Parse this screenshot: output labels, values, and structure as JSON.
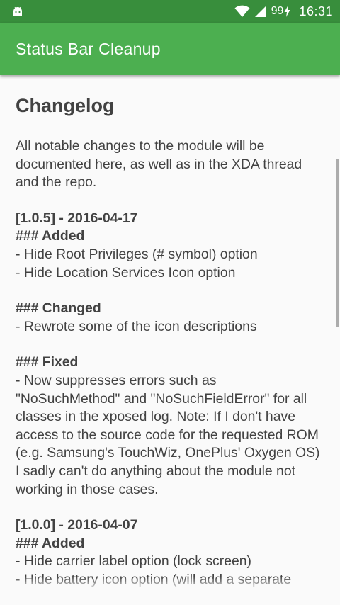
{
  "status_bar": {
    "battery_level": "99",
    "time": "16:31",
    "icons": [
      "android-icon",
      "wifi-icon",
      "signal-icon",
      "battery-charging-icon"
    ]
  },
  "app_bar": {
    "title": "Status Bar Cleanup",
    "color": "#4caf50",
    "status_color": "#388e3c"
  },
  "changelog": {
    "heading": "Changelog",
    "intro": "All notable changes to the module will be documented here, as well as in the XDA thread and the repo.",
    "releases": [
      {
        "version": "[1.0.5] - 2016-04-17",
        "sections": [
          {
            "heading": "### Added",
            "items": [
              "- Hide Root Privileges (# symbol) option",
              "- Hide Location Services Icon option"
            ]
          },
          {
            "heading": "### Changed",
            "items": [
              "- Rewrote some of the icon descriptions"
            ]
          },
          {
            "heading": "### Fixed",
            "items": [
              "- Now suppresses errors such as \"NoSuchMethod\" and \"NoSuchFieldError\" for all classes in the xposed log. Note: If I don't have access to the source code for the requested ROM (e.g. Samsung's TouchWiz, OnePlus' Oxygen OS) I sadly can't do anything about the module not working in those cases."
            ]
          }
        ]
      },
      {
        "version": "[1.0.0] - 2016-04-07",
        "sections": [
          {
            "heading": "### Added",
            "items": [
              "- Hide carrier label option (lock screen)",
              "- Hide battery icon option (will add a separate option for lockscreen later on)"
            ]
          }
        ]
      }
    ]
  }
}
